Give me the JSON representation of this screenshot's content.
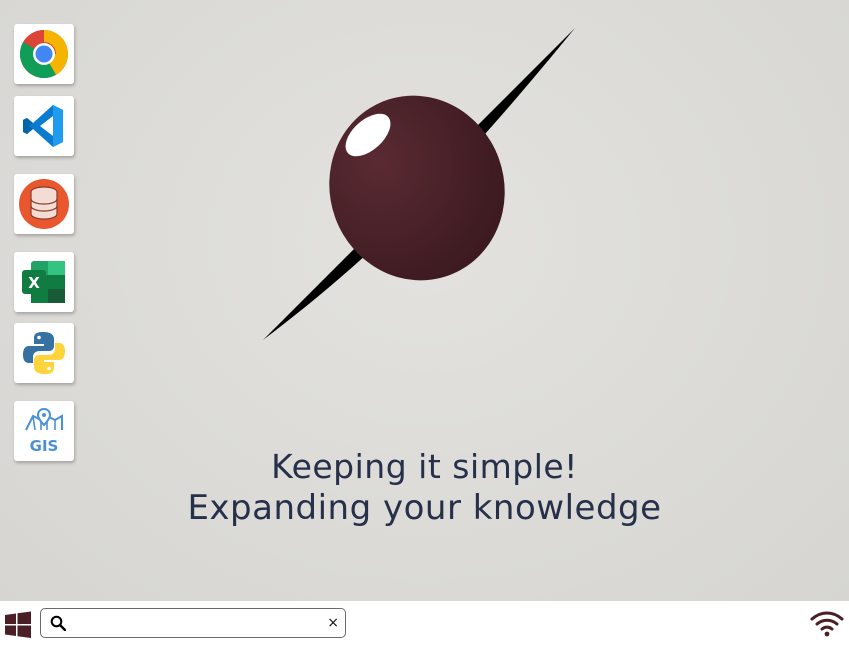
{
  "desktop": {
    "icons": [
      {
        "name": "Google Chrome",
        "icon": "chrome-icon"
      },
      {
        "name": "Visual Studio Code",
        "icon": "vscode-icon"
      },
      {
        "name": "Database",
        "icon": "database-icon"
      },
      {
        "name": "Microsoft Excel",
        "icon": "excel-icon"
      },
      {
        "name": "Python",
        "icon": "python-icon"
      },
      {
        "name": "GIS",
        "icon": "gis-icon",
        "label": "GIS"
      }
    ],
    "excel_letter": "X"
  },
  "tagline": {
    "line1": "Keeping it simple!",
    "line2": "Expanding your knowledge"
  },
  "taskbar": {
    "search": {
      "value": "",
      "placeholder": "",
      "clear_label": "×"
    },
    "icons": [
      "windows-start-icon",
      "search-icon",
      "wifi-icon"
    ]
  },
  "colors": {
    "desktop_background": "#dcdbd7",
    "logo_ellipse": "#4a1f26",
    "logo_needle": "#000000",
    "tagline_text": "#27304a",
    "taskbar": "#ffffff",
    "start_icon": "#4a1f26"
  }
}
